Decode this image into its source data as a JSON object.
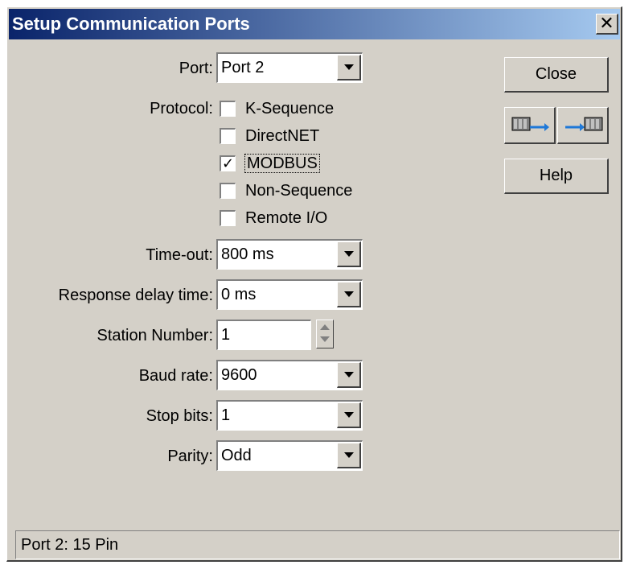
{
  "window": {
    "title": "Setup Communication Ports",
    "close_glyph": "✕"
  },
  "fields": {
    "port": {
      "label": "Port:",
      "value": "Port 2"
    },
    "protocol": {
      "label": "Protocol:",
      "options": [
        {
          "label": "K-Sequence",
          "checked": false
        },
        {
          "label": "DirectNET",
          "checked": false
        },
        {
          "label": "MODBUS",
          "checked": true
        },
        {
          "label": "Non-Sequence",
          "checked": false
        },
        {
          "label": "Remote I/O",
          "checked": false
        }
      ],
      "check_glyph": "✓"
    },
    "timeout": {
      "label": "Time-out:",
      "value": "800 ms"
    },
    "response_delay": {
      "label": "Response delay time:",
      "value": "0 ms"
    },
    "station_number": {
      "label": "Station Number:",
      "value": "1"
    },
    "baud_rate": {
      "label": "Baud rate:",
      "value": "9600"
    },
    "stop_bits": {
      "label": "Stop bits:",
      "value": "1"
    },
    "parity": {
      "label": "Parity:",
      "value": "Odd"
    }
  },
  "buttons": {
    "close": "Close",
    "help": "Help",
    "write_icon": "plc-write-icon",
    "read_icon": "plc-read-icon"
  },
  "status_bar": {
    "text": "Port 2: 15 Pin"
  }
}
